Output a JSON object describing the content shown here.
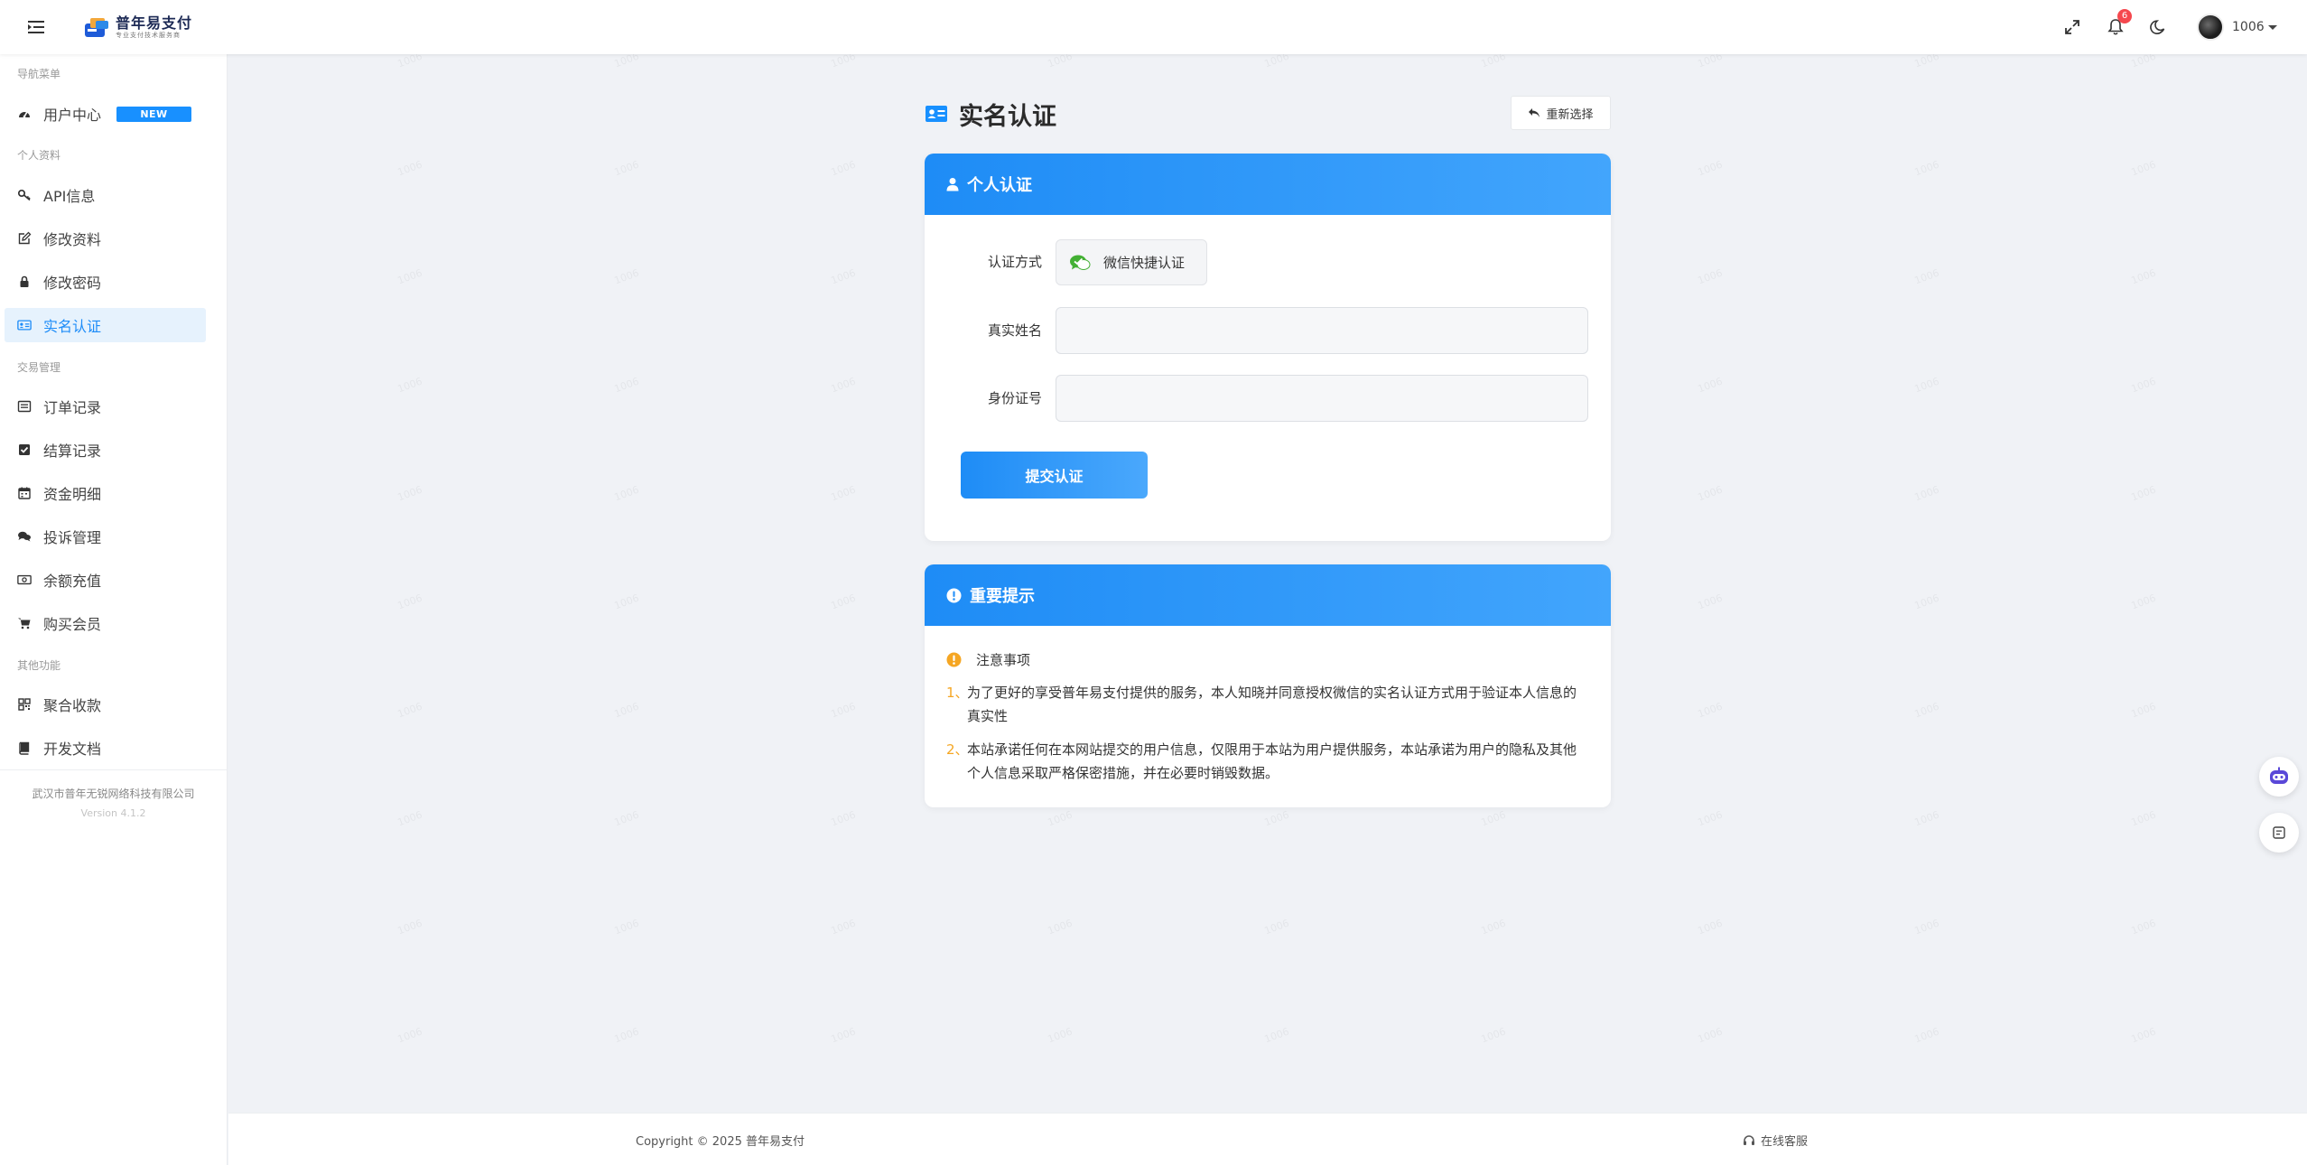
{
  "header": {
    "logo_title": "普年易支付",
    "logo_subtitle": "专业支付技术服务商",
    "notification_count": "6",
    "username": "1006"
  },
  "sidebar": {
    "groups": [
      {
        "title": "导航菜单"
      },
      {
        "title": "个人资料"
      },
      {
        "title": "交易管理"
      },
      {
        "title": "其他功能"
      }
    ],
    "items": [
      {
        "label": "用户中心",
        "badge": "NEW",
        "icon": "dashboard-icon"
      },
      {
        "label": "API信息",
        "icon": "key-icon"
      },
      {
        "label": "修改资料",
        "icon": "edit-icon"
      },
      {
        "label": "修改密码",
        "icon": "lock-icon"
      },
      {
        "label": "实名认证",
        "icon": "id-card-icon",
        "active": true
      },
      {
        "label": "订单记录",
        "icon": "list-icon"
      },
      {
        "label": "结算记录",
        "icon": "check-square-icon"
      },
      {
        "label": "资金明细",
        "icon": "calendar-icon"
      },
      {
        "label": "投诉管理",
        "icon": "comments-icon"
      },
      {
        "label": "余额充值",
        "icon": "money-icon"
      },
      {
        "label": "购买会员",
        "icon": "cart-icon"
      },
      {
        "label": "聚合收款",
        "icon": "qrcode-icon"
      },
      {
        "label": "开发文档",
        "icon": "book-icon"
      }
    ],
    "company": "武汉市普年无锐网络科技有限公司",
    "version": "Version 4.1.2"
  },
  "page": {
    "title": "实名认证",
    "reselect_label": "重新选择"
  },
  "personal_card": {
    "title": "个人认证",
    "method_label": "认证方式",
    "method_value": "微信快捷认证",
    "name_label": "真实姓名",
    "name_value": "",
    "name_placeholder": "",
    "id_label": "身份证号",
    "id_value": "",
    "id_placeholder": "",
    "submit_label": "提交认证"
  },
  "notice_card": {
    "title": "重要提示",
    "subheading": "注意事项",
    "items": [
      {
        "num": "1、",
        "text": "为了更好的享受普年易支付提供的服务，本人知晓并同意授权微信的实名认证方式用于验证本人信息的真实性"
      },
      {
        "num": "2、",
        "text": "本站承诺任何在本网站提交的用户信息，仅限用于本站为用户提供服务，本站承诺为用户的隐私及其他个人信息采取严格保密措施，并在必要时销毁数据。"
      }
    ]
  },
  "footer": {
    "copyright": "Copyright © 2025 普年易支付",
    "support": "在线客服"
  },
  "watermark_text": "1006",
  "colors": {
    "primary": "#1890ff",
    "header_gradient_start": "#1e8cf6",
    "header_gradient_end": "#42a5fc",
    "active_bg": "#e6f2fd",
    "badge_red": "#f5484e",
    "warning": "#f5a623",
    "wechat_green": "#43b034"
  }
}
